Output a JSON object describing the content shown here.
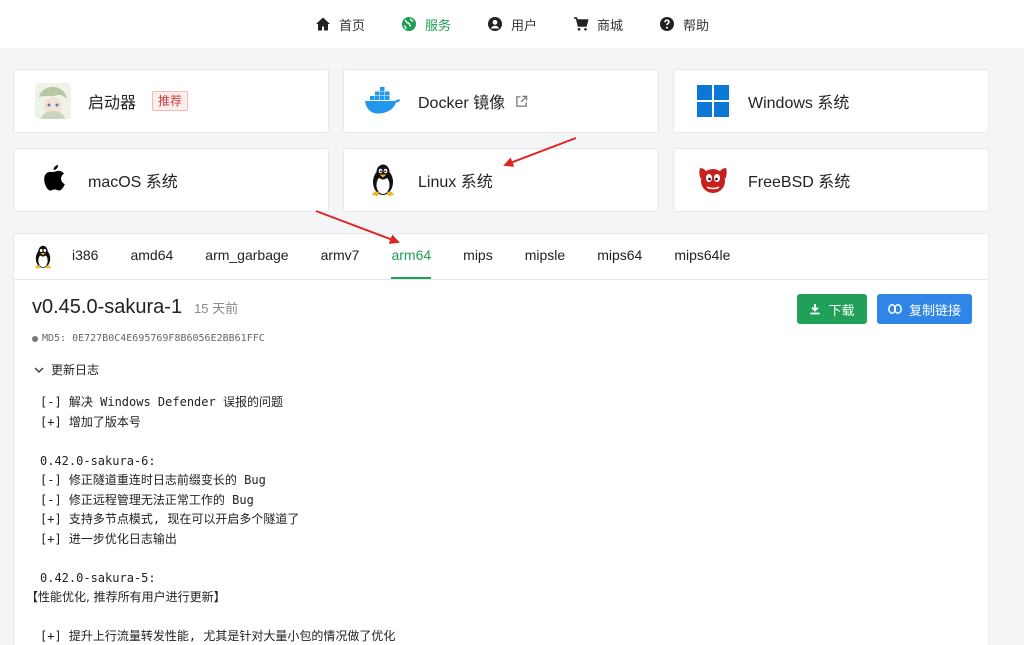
{
  "nav": [
    {
      "label": "首页",
      "icon": "home-icon",
      "active": false
    },
    {
      "label": "服务",
      "icon": "globe-icon",
      "active": true
    },
    {
      "label": "用户",
      "icon": "user-icon",
      "active": false
    },
    {
      "label": "商城",
      "icon": "cart-icon",
      "active": false
    },
    {
      "label": "帮助",
      "icon": "help-icon",
      "active": false
    }
  ],
  "cards": [
    {
      "label": "启动器",
      "icon": "avatar-icon",
      "badge": "推荐"
    },
    {
      "label": "Docker 镜像",
      "icon": "docker-icon",
      "external": true
    },
    {
      "label": "Windows 系统",
      "icon": "windows-icon"
    },
    {
      "label": "macOS 系统",
      "icon": "apple-icon"
    },
    {
      "label": "Linux 系统",
      "icon": "tux-icon"
    },
    {
      "label": "FreeBSD 系统",
      "icon": "freebsd-icon"
    }
  ],
  "arch_tabs": [
    "i386",
    "amd64",
    "arm_garbage",
    "armv7",
    "arm64",
    "mips",
    "mipsle",
    "mips64",
    "mips64le"
  ],
  "active_arch": "arm64",
  "release": {
    "version": "v0.45.0-sakura-1",
    "age": "15 天前",
    "md5": "MD5: 0E727B0C4E695769F8B6056E2BB61FFC"
  },
  "buttons": {
    "download": "下载",
    "copy_link": "复制链接"
  },
  "changelog": {
    "toggle_label": "更新日志",
    "lines": [
      "[-] 解决 Windows Defender 误报的问题",
      "[+] 增加了版本号",
      "",
      "0.42.0-sakura-6:",
      "[-] 修正隧道重连时日志前缀变长的 Bug",
      "[-] 修正远程管理无法正常工作的 Bug",
      "[+] 支持多节点模式, 现在可以开启多个隧道了",
      "[+] 进一步优化日志输出",
      "",
      "0.42.0-sakura-5:",
      "【性能优化, 推荐所有用户进行更新】",
      "",
      "[+] 提升上行流量转发性能, 尤其是针对大量小包的情况做了优化"
    ]
  },
  "colors": {
    "accent_green": "#1e9e55",
    "button_blue": "#2f86e6",
    "annotation_red": "#e02424"
  }
}
